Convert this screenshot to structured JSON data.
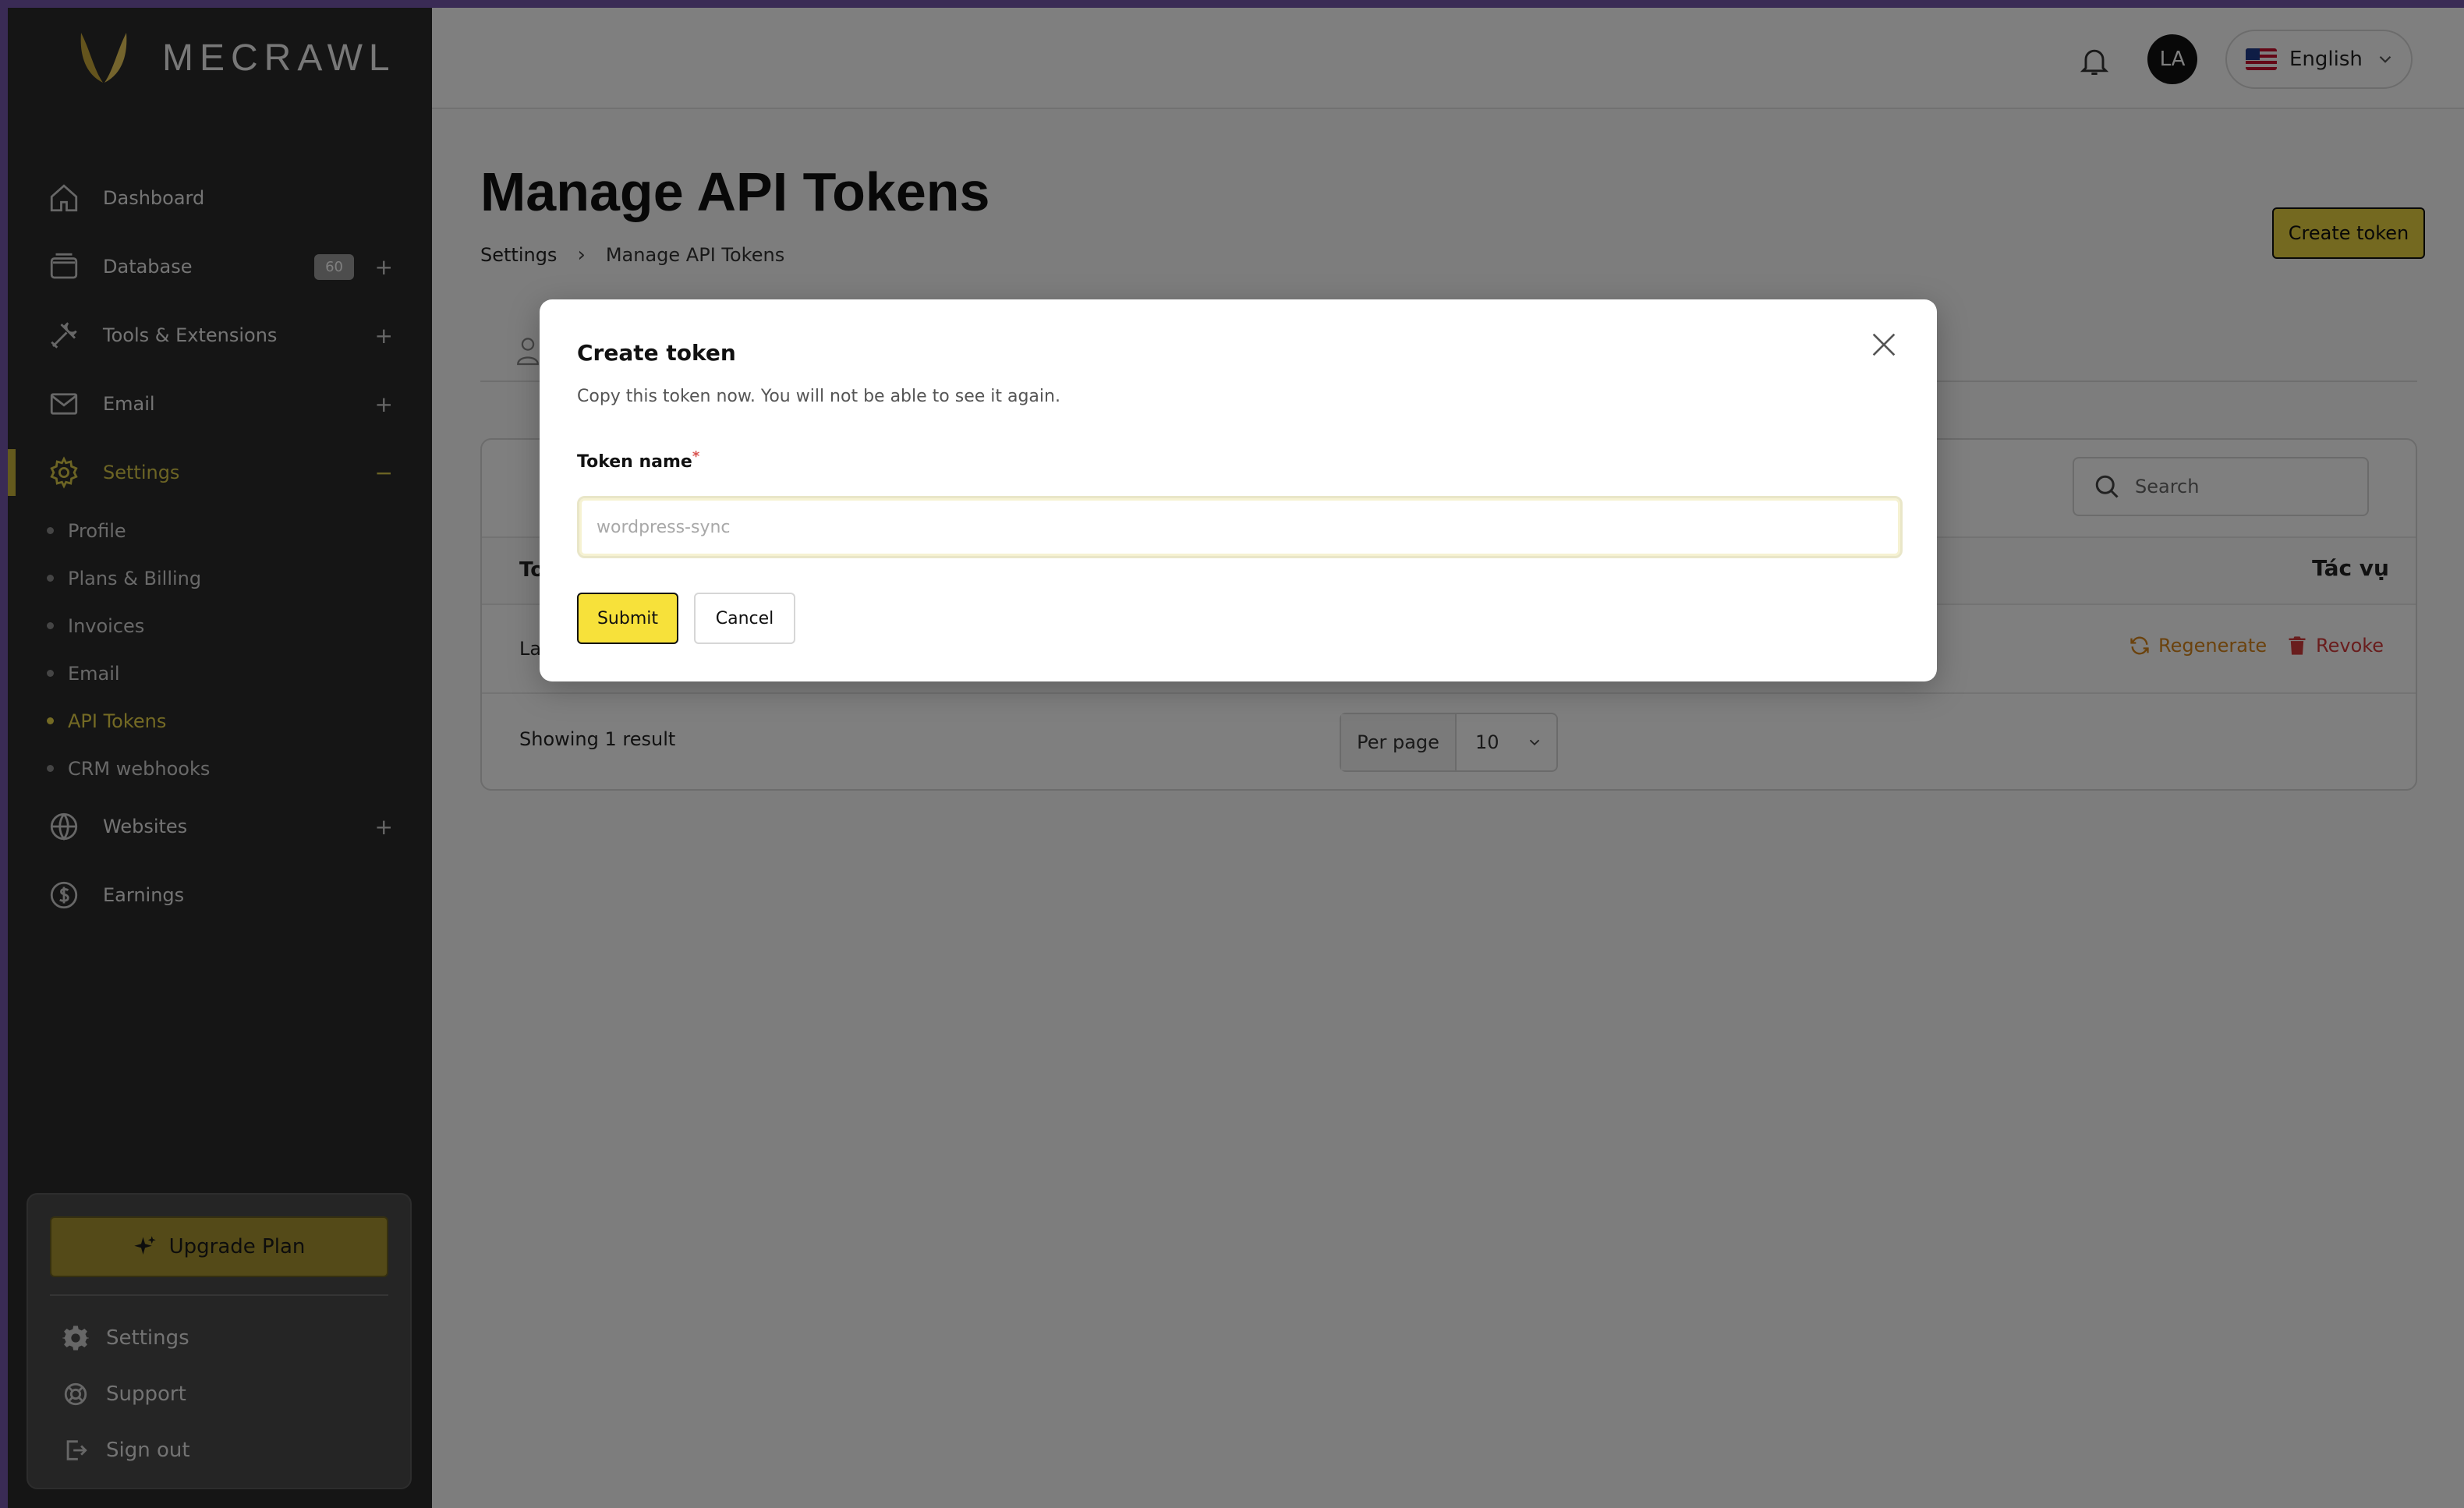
{
  "brand": {
    "name": "MECRAWL",
    "accent": "#e8d340"
  },
  "sidebar": {
    "items": [
      {
        "label": "Dashboard",
        "icon": "home-icon"
      },
      {
        "label": "Database",
        "icon": "database-icon",
        "badge": "60"
      },
      {
        "label": "Tools & Extensions",
        "icon": "tools-icon"
      },
      {
        "label": "Email",
        "icon": "mail-icon"
      },
      {
        "label": "Settings",
        "icon": "gear-icon"
      },
      {
        "label": "Websites",
        "icon": "globe-icon"
      },
      {
        "label": "Earnings",
        "icon": "dollar-icon"
      }
    ],
    "settings_sub": [
      "Profile",
      "Plans & Billing",
      "Invoices",
      "Email",
      "API Tokens",
      "CRM webhooks"
    ],
    "footer": {
      "upgrade": "Upgrade Plan",
      "settings": "Settings",
      "support": "Support",
      "signout": "Sign out"
    }
  },
  "topbar": {
    "avatar": "LA",
    "language": "English"
  },
  "page": {
    "title": "Manage API Tokens",
    "breadcrumb": [
      "Settings",
      "Manage API Tokens"
    ],
    "create_button": "Create token"
  },
  "table": {
    "search_placeholder": "Search",
    "col_first_partial": "To",
    "col_actions": "Tác vụ",
    "row_name_partial": "La",
    "regenerate": "Regenerate",
    "revoke": "Revoke",
    "showing": "Showing 1 result",
    "per_page_label": "Per page",
    "per_page_value": "10"
  },
  "modal": {
    "title": "Create token",
    "description": "Copy this token now. You will not be able to see it again.",
    "field_label": "Token name",
    "required_mark": "*",
    "placeholder": "wordpress-sync",
    "submit": "Submit",
    "cancel": "Cancel"
  }
}
